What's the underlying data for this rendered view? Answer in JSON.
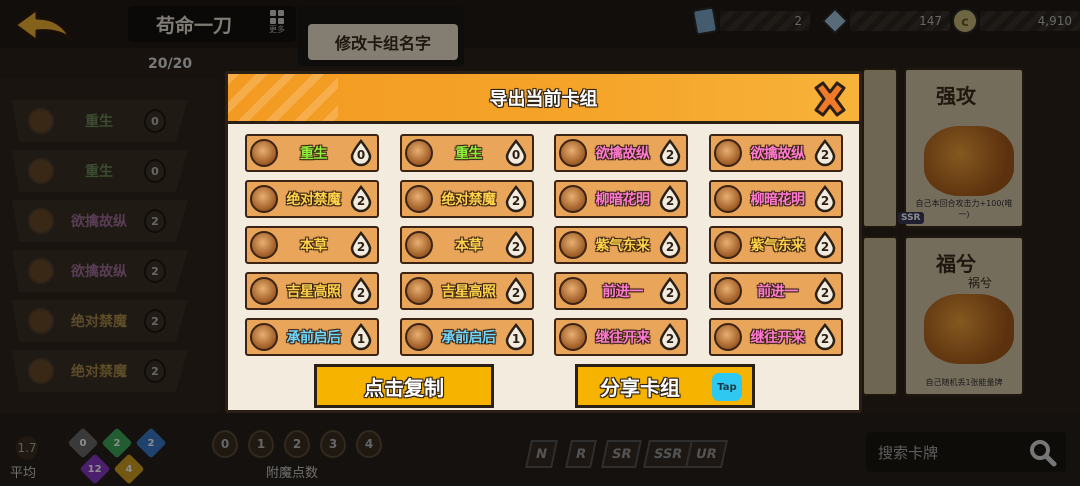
{
  "background": {
    "deck_name": "苟命一刀",
    "more_label": "更多",
    "rename_label": "修改卡组名字",
    "card_count": "20/20",
    "resources": [
      {
        "icon": "card-pack-icon",
        "value": "2"
      },
      {
        "icon": "diamond-icon",
        "value": "147"
      },
      {
        "icon": "coin-icon",
        "value": "4,910"
      }
    ],
    "side_list": [
      {
        "name": "重生",
        "cost": "0"
      },
      {
        "name": "重生",
        "cost": "0"
      },
      {
        "name": "欲擒故纵",
        "cost": "2"
      },
      {
        "name": "欲擒故纵",
        "cost": "2"
      },
      {
        "name": "绝对禁魔",
        "cost": "2"
      },
      {
        "name": "绝对禁魔",
        "cost": "2"
      }
    ],
    "right_cards": [
      {
        "title": "强攻",
        "subtitle": "",
        "desc": "自己本回合攻击力+100(唯一)"
      },
      {
        "title": "福兮",
        "subtitle": "祸兮",
        "desc": "自己随机丢1张能量牌"
      }
    ],
    "ssr_tag": "SSR",
    "average": {
      "value": "1.7",
      "label": "平均"
    },
    "gems": [
      "0",
      "2",
      "2",
      "12",
      "4"
    ],
    "enchant_filters": [
      "0",
      "1",
      "2",
      "3",
      "4"
    ],
    "enchant_label": "附魔点数",
    "rarities": [
      "N",
      "R",
      "SR",
      "SSR",
      "UR"
    ],
    "search_placeholder": "搜索卡牌"
  },
  "modal": {
    "title": "导出当前卡组",
    "cards": [
      {
        "name": "重生",
        "cost": "0",
        "color": "#8ff03a"
      },
      {
        "name": "重生",
        "cost": "0",
        "color": "#8ff03a"
      },
      {
        "name": "欲擒故纵",
        "cost": "2",
        "color": "#ff7ad0"
      },
      {
        "name": "欲擒故纵",
        "cost": "2",
        "color": "#ff7ad0"
      },
      {
        "name": "绝对禁魔",
        "cost": "2",
        "color": "#ffd24a"
      },
      {
        "name": "绝对禁魔",
        "cost": "2",
        "color": "#ffd24a"
      },
      {
        "name": "柳暗花明",
        "cost": "2",
        "color": "#ff7ad0"
      },
      {
        "name": "柳暗花明",
        "cost": "2",
        "color": "#ff7ad0"
      },
      {
        "name": "本草",
        "cost": "2",
        "color": "#ffd24a"
      },
      {
        "name": "本草",
        "cost": "2",
        "color": "#ffd24a"
      },
      {
        "name": "紫气东来",
        "cost": "2",
        "color": "#ffd24a"
      },
      {
        "name": "紫气东来",
        "cost": "2",
        "color": "#ffd24a"
      },
      {
        "name": "吉星高照",
        "cost": "2",
        "color": "#ffd24a"
      },
      {
        "name": "吉星高照",
        "cost": "2",
        "color": "#ffd24a"
      },
      {
        "name": "前进一",
        "cost": "2",
        "color": "#ff7ad0"
      },
      {
        "name": "前进一",
        "cost": "2",
        "color": "#ff7ad0"
      },
      {
        "name": "承前启后",
        "cost": "1",
        "color": "#6fd8ff"
      },
      {
        "name": "承前启后",
        "cost": "1",
        "color": "#6fd8ff"
      },
      {
        "name": "继往开来",
        "cost": "2",
        "color": "#ff7ad0"
      },
      {
        "name": "继往开来",
        "cost": "2",
        "color": "#ff7ad0"
      }
    ],
    "copy_label": "点击复制",
    "share_label": "分享卡组",
    "tap_label": "Tap"
  }
}
